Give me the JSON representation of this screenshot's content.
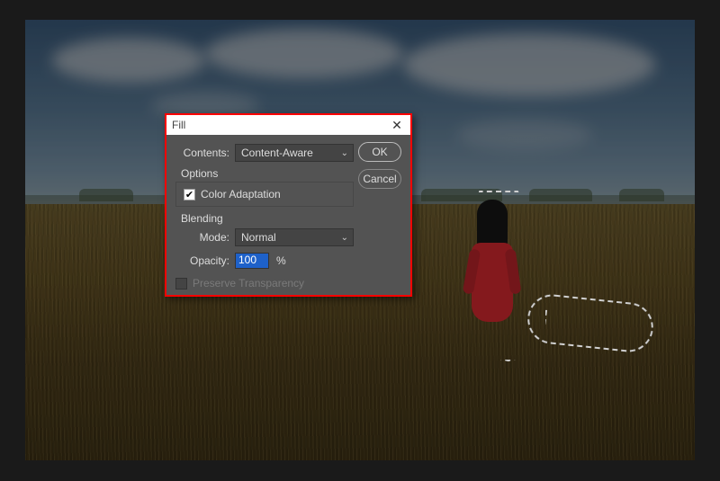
{
  "dialog": {
    "title": "Fill",
    "contents_label": "Contents:",
    "contents_value": "Content-Aware",
    "options_label": "Options",
    "color_adaptation_label": "Color Adaptation",
    "color_adaptation_checked": true,
    "blending_label": "Blending",
    "mode_label": "Mode:",
    "mode_value": "Normal",
    "opacity_label": "Opacity:",
    "opacity_value": "100",
    "opacity_unit": "%",
    "preserve_label": "Preserve Transparency",
    "preserve_checked": false,
    "ok_label": "OK",
    "cancel_label": "Cancel"
  }
}
